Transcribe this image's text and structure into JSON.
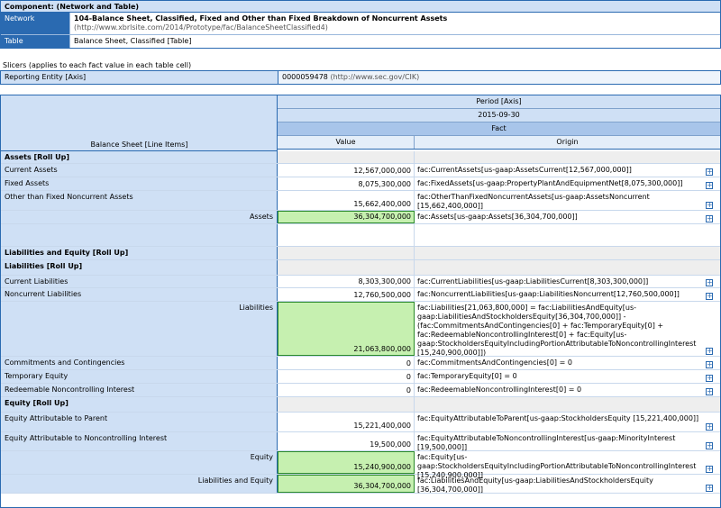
{
  "component": {
    "title": "Component: (Network and Table)",
    "network_label": "Network",
    "network_name": "104-Balance Sheet, Classified, Fixed and Other than Fixed Breakdown of Noncurrent Assets",
    "network_url": "(http://www.xbrlsite.com/2014/Prototype/fac/BalanceSheetClassified4)",
    "table_label": "Table",
    "table_name": "Balance Sheet, Classified [Table]"
  },
  "slicers": {
    "caption": "Slicers (applies to each fact value in each table cell)",
    "label": "Reporting Entity [Axis]",
    "value": "0000059478",
    "value_url": "(http://www.sec.gov/CIK)"
  },
  "table": {
    "line_items_header": "Balance Sheet [Line Items]",
    "period_axis": "Period [Axis]",
    "period": "2015-09-30",
    "fact": "Fact",
    "value_col": "Value",
    "origin_col": "Origin"
  },
  "rows": [
    {
      "label": "Assets [Roll Up]",
      "type": "section"
    },
    {
      "label": "Current Assets",
      "value": "12,567,000,000",
      "origin": "fac:CurrentAssets[us-gaap:AssetsCurrent[12,567,000,000]]"
    },
    {
      "label": "Fixed Assets",
      "value": "8,075,300,000",
      "origin": "fac:FixedAssets[us-gaap:PropertyPlantAndEquipmentNet[8,075,300,000]]"
    },
    {
      "label": "Other than Fixed Noncurrent Assets",
      "value": "15,662,400,000",
      "origin": "fac:OtherThanFixedNoncurrentAssets[us-gaap:AssetsNoncurrent [15,662,400,000]]"
    },
    {
      "label": "Assets",
      "value": "36,304,700,000",
      "origin": "fac:Assets[us-gaap:Assets[36,304,700,000]]",
      "type": "total"
    },
    {
      "label": "",
      "type": "blank"
    },
    {
      "label": "Liabilities and Equity [Roll Up]",
      "type": "section"
    },
    {
      "label": "Liabilities [Roll Up]",
      "type": "section"
    },
    {
      "label": "Current Liabilities",
      "value": "8,303,300,000",
      "origin": "fac:CurrentLiabilities[us-gaap:LiabilitiesCurrent[8,303,300,000]]"
    },
    {
      "label": "Noncurrent Liabilities",
      "value": "12,760,500,000",
      "origin": "fac:NoncurrentLiabilities[us-gaap:LiabilitiesNoncurrent[12,760,500,000]]"
    },
    {
      "label": "Liabilities",
      "value": "21,063,800,000",
      "origin": "fac:Liabilities[21,063,800,000] = fac:LiabilitiesAndEquity[us-gaap:LiabilitiesAndStockholdersEquity[36,304,700,000]] - (fac:CommitmentsAndContingencies[0] + fac:TemporaryEquity[0] + fac:RedeemableNoncontrollingInterest[0] + fac:Equity[us-gaap:StockholdersEquityIncludingPortionAttributableToNoncontrollingInterest [15,240,900,000]])",
      "type": "total"
    },
    {
      "label": "Commitments and Contingencies",
      "value": "0",
      "origin": "fac:CommitmentsAndContingencies[0] = 0"
    },
    {
      "label": "Temporary Equity",
      "value": "0",
      "origin": "fac:TemporaryEquity[0] = 0"
    },
    {
      "label": "Redeemable Noncontrolling Interest",
      "value": "0",
      "origin": "fac:RedeemableNoncontrollingInterest[0] = 0"
    },
    {
      "label": "Equity [Roll Up]",
      "type": "section"
    },
    {
      "label": "Equity Attributable to Parent",
      "value": "15,221,400,000",
      "origin": "fac:EquityAttributableToParent[us-gaap:StockholdersEquity [15,221,400,000]]"
    },
    {
      "label": "Equity Attributable to Noncontrolling Interest",
      "value": "19,500,000",
      "origin": "fac:EquityAttributableToNoncontrollingInterest[us-gaap:MinorityInterest [19,500,000]]"
    },
    {
      "label": "Equity",
      "value": "15,240,900,000",
      "origin": "fac:Equity[us-gaap:StockholdersEquityIncludingPortionAttributableToNoncontrollingInterest [15,240,900,000]]",
      "type": "total"
    },
    {
      "label": "Liabilities and Equity",
      "value": "36,304,700,000",
      "origin": "fac:LiabilitiesAndEquity[us-gaap:LiabilitiesAndStockholdersEquity [36,304,700,000]]",
      "type": "total"
    }
  ]
}
